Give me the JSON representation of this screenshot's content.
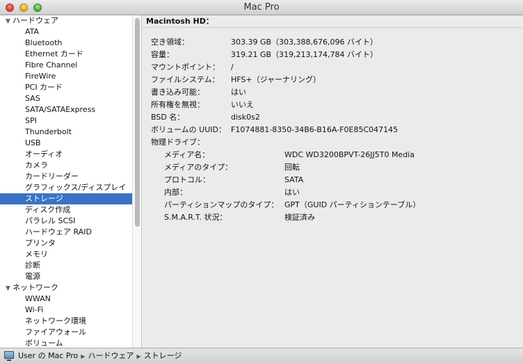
{
  "window": {
    "title": "Mac Pro"
  },
  "sidebar": {
    "selected": "ストレージ",
    "rows": [
      {
        "type": "category",
        "label": "ハードウェア",
        "expanded": true
      },
      {
        "type": "item",
        "label": "ATA"
      },
      {
        "type": "item",
        "label": "Bluetooth"
      },
      {
        "type": "item",
        "label": "Ethernet カード"
      },
      {
        "type": "item",
        "label": "Fibre Channel"
      },
      {
        "type": "item",
        "label": "FireWire"
      },
      {
        "type": "item",
        "label": "PCI カード"
      },
      {
        "type": "item",
        "label": "SAS"
      },
      {
        "type": "item",
        "label": "SATA/SATAExpress"
      },
      {
        "type": "item",
        "label": "SPI"
      },
      {
        "type": "item",
        "label": "Thunderbolt"
      },
      {
        "type": "item",
        "label": "USB"
      },
      {
        "type": "item",
        "label": "オーディオ"
      },
      {
        "type": "item",
        "label": "カメラ"
      },
      {
        "type": "item",
        "label": "カードリーダー"
      },
      {
        "type": "item",
        "label": "グラフィックス/ディスプレイ"
      },
      {
        "type": "item",
        "label": "ストレージ"
      },
      {
        "type": "item",
        "label": "ディスク作成"
      },
      {
        "type": "item",
        "label": "パラレル SCSI"
      },
      {
        "type": "item",
        "label": "ハードウェア RAID"
      },
      {
        "type": "item",
        "label": "プリンタ"
      },
      {
        "type": "item",
        "label": "メモリ"
      },
      {
        "type": "item",
        "label": "診断"
      },
      {
        "type": "item",
        "label": "電源"
      },
      {
        "type": "category",
        "label": "ネットワーク",
        "expanded": true
      },
      {
        "type": "item",
        "label": "WWAN"
      },
      {
        "type": "item",
        "label": "Wi-Fi"
      },
      {
        "type": "item",
        "label": "ネットワーク環境"
      },
      {
        "type": "item",
        "label": "ファイアウォール"
      },
      {
        "type": "item",
        "label": "ボリューム"
      }
    ]
  },
  "main": {
    "title": "Macintosh HD：",
    "properties": [
      {
        "label": "空き領域：",
        "value": "303.39 GB（303,388,676,096 バイト）",
        "indent": 0
      },
      {
        "label": "容量：",
        "value": "319.21 GB（319,213,174,784 バイト）",
        "indent": 0
      },
      {
        "label": "マウントポイント：",
        "value": "/",
        "indent": 0
      },
      {
        "label": "ファイルシステム：",
        "value": "HFS+（ジャーナリング）",
        "indent": 0
      },
      {
        "label": "書き込み可能：",
        "value": "はい",
        "indent": 0
      },
      {
        "label": "所有権を無視：",
        "value": "いいえ",
        "indent": 0
      },
      {
        "label": "BSD 名：",
        "value": "disk0s2",
        "indent": 0
      },
      {
        "label": "ボリュームの UUID：",
        "value": "F1074881-8350-34B6-B16A-F0E85C047145",
        "indent": 0
      },
      {
        "label": "物理ドライブ：",
        "value": "",
        "indent": 0
      },
      {
        "label": "メディア名：",
        "value": "WDC WD3200BPVT-26JJ5T0 Media",
        "indent": 1
      },
      {
        "label": "メディアのタイプ：",
        "value": "回転",
        "indent": 1
      },
      {
        "label": "プロトコル：",
        "value": "SATA",
        "indent": 1
      },
      {
        "label": "内部：",
        "value": "はい",
        "indent": 1
      },
      {
        "label": "パーティションマップのタイプ：",
        "value": "GPT（GUID パーティションテーブル）",
        "indent": 1
      },
      {
        "label": "S.M.A.R.T. 状況：",
        "value": "検証済み",
        "indent": 1
      }
    ]
  },
  "statusbar": {
    "icon": "computer-icon",
    "path": [
      "User の Mac Pro",
      "ハードウェア",
      "ストレージ"
    ],
    "separator": "▶"
  },
  "colors": {
    "selection": "#3b73c4"
  }
}
